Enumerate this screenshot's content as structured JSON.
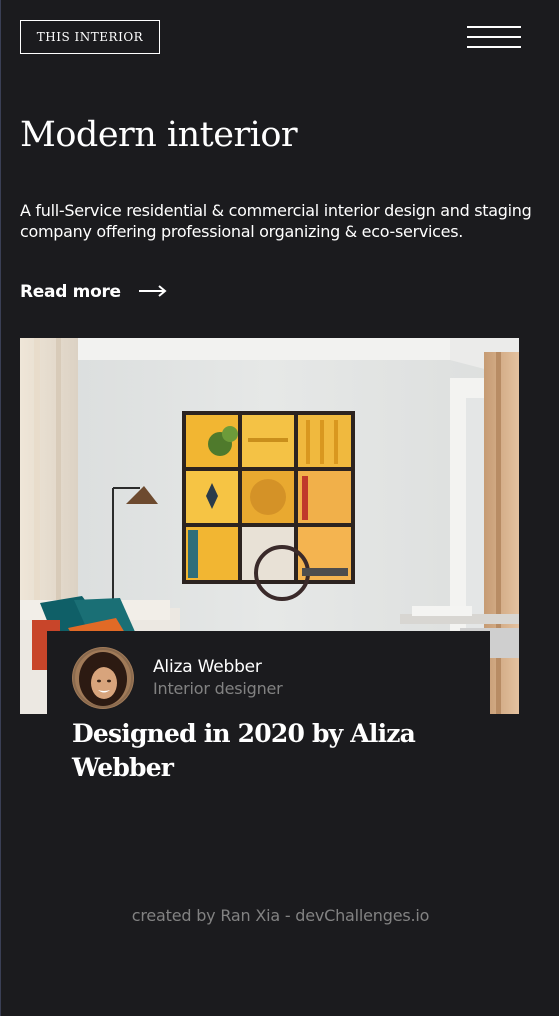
{
  "header": {
    "logo_text": "THIS INTERIOR",
    "menu_icon": "hamburger-menu-icon"
  },
  "hero": {
    "title": "Modern interior",
    "description": "A full-Service residential & commercial interior design and staging company offering professional organizing & eco-services.",
    "read_more_label": "Read more",
    "read_more_icon": "arrow-right-icon"
  },
  "card": {
    "author_name": "Aliza Webber",
    "author_role": "Interior designer",
    "headline": "Designed in 2020 by Aliza Webber"
  },
  "footer": {
    "credit": "created by Ran Xia - devChallenges.io"
  },
  "colors": {
    "background": "#1b1b1e",
    "text": "#ffffff",
    "muted": "#828282",
    "frame_yellow": "#f2b632"
  }
}
